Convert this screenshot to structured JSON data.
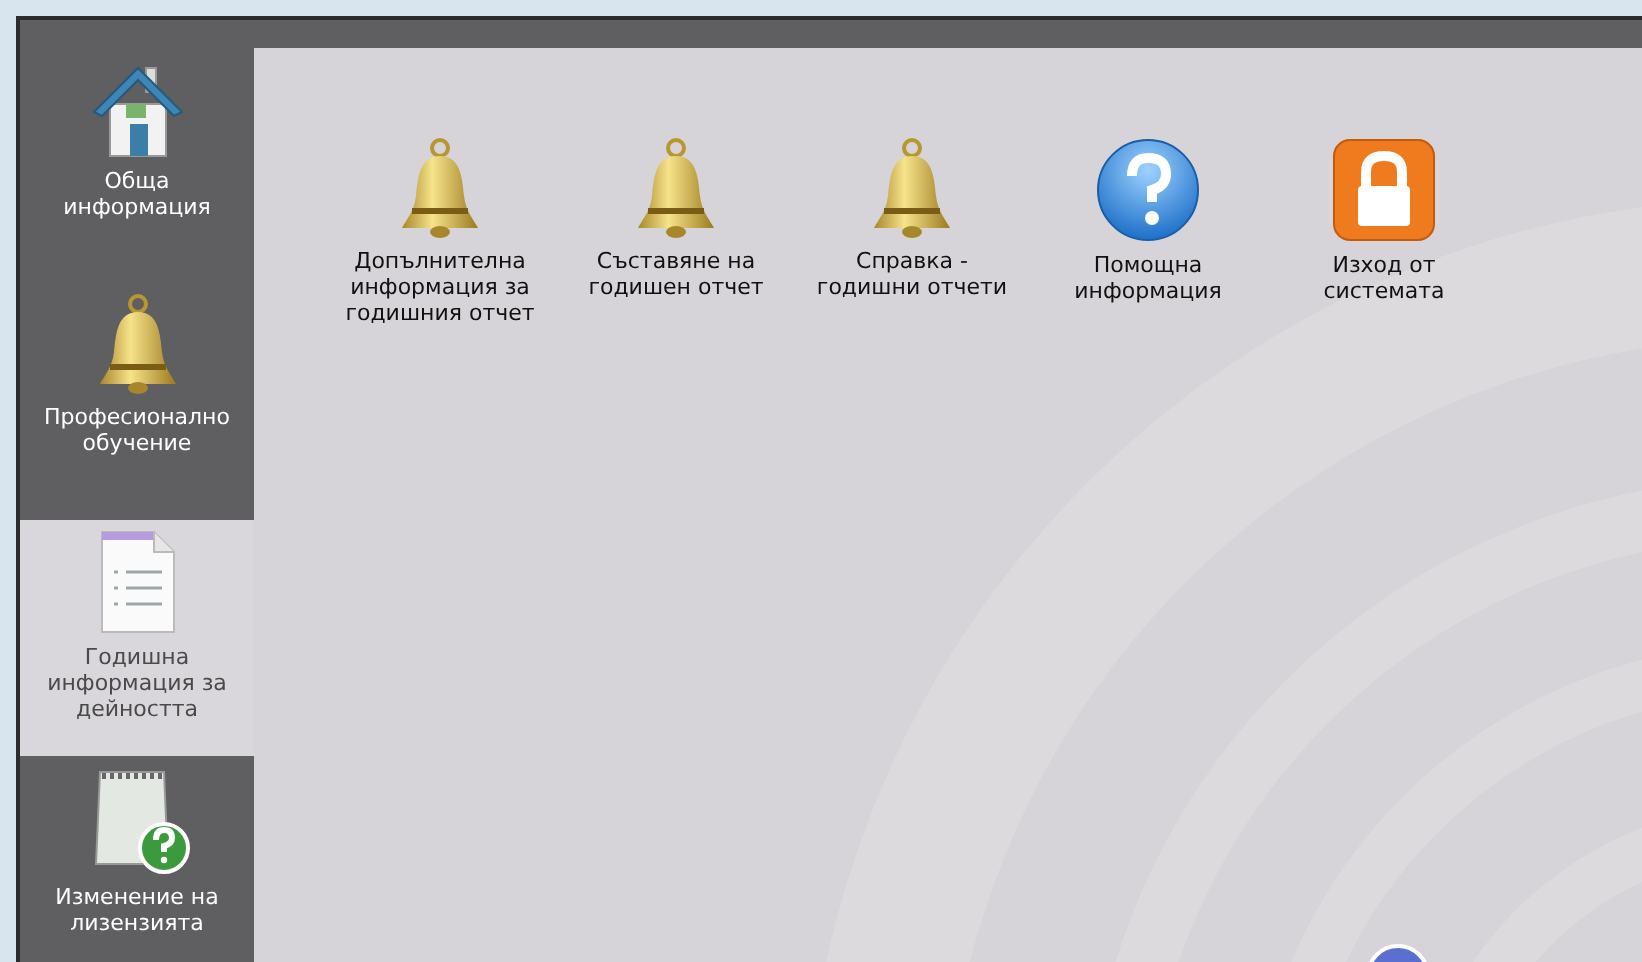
{
  "sidebar": {
    "items": [
      {
        "label": "Обща информация",
        "kind": "house",
        "selected": false
      },
      {
        "label": "Професионално обучение",
        "kind": "bell",
        "selected": false
      },
      {
        "label": "Годишна информация за дейността",
        "kind": "document",
        "selected": true
      },
      {
        "label": "Изменение на лизензията",
        "kind": "notepad",
        "selected": false
      }
    ]
  },
  "main": {
    "items": [
      {
        "label": "Допълнителна информация за годишния отчет",
        "kind": "bell"
      },
      {
        "label": "Съставяне на годишен отчет",
        "kind": "bell"
      },
      {
        "label": "Справка - годишни отчети",
        "kind": "bell"
      },
      {
        "label": "Помощна информация",
        "kind": "help"
      },
      {
        "label": "Изход от системата",
        "kind": "lock"
      }
    ]
  }
}
